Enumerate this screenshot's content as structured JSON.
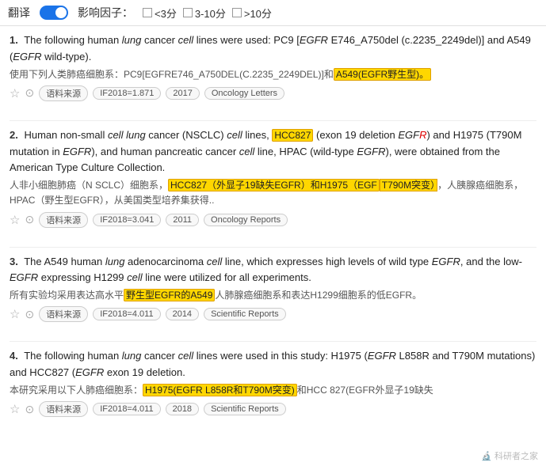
{
  "topbar": {
    "translate_label": "翻译",
    "factor_label": "影响因子：",
    "factor_options": [
      {
        "label": "<3分",
        "checked": false
      },
      {
        "label": "3-10分",
        "checked": false
      },
      {
        "label": ">10分",
        "checked": false
      }
    ]
  },
  "results": [
    {
      "num": "1.",
      "en_parts": [
        {
          "text": "The following human ",
          "style": "normal"
        },
        {
          "text": "lung",
          "style": "italic"
        },
        {
          "text": " cancer ",
          "style": "normal"
        },
        {
          "text": "cell",
          "style": "italic"
        },
        {
          "text": " lines were used: PC9 [",
          "style": "normal"
        },
        {
          "text": "EGFR",
          "style": "egfr"
        },
        {
          "text": " E746_A750del (c.2235_2249del)] and A549 (",
          "style": "normal"
        },
        {
          "text": "EGFR",
          "style": "egfr"
        },
        {
          "text": " wild-type).",
          "style": "normal"
        }
      ],
      "cn_parts": [
        {
          "text": "使用下列人类肺癌细胞系：PC9[EGFRE746_A750DEL(C.2235_2249DEL)]和",
          "style": "normal"
        },
        {
          "text": "A549(EGFR野生型)。",
          "style": "highlight"
        }
      ],
      "tags": [
        "语料来源",
        "IF2018=1.871",
        "2017",
        "Oncology Letters"
      ]
    },
    {
      "num": "2.",
      "en_parts": [
        {
          "text": "Human non-small ",
          "style": "normal"
        },
        {
          "text": "cell",
          "style": "italic"
        },
        {
          "text": " ",
          "style": "normal"
        },
        {
          "text": "lung",
          "style": "italic"
        },
        {
          "text": " cancer (NSCLC) ",
          "style": "normal"
        },
        {
          "text": "cell",
          "style": "italic"
        },
        {
          "text": " lines, ",
          "style": "normal"
        },
        {
          "text": "HCC827",
          "style": "highlight-inline"
        },
        {
          "text": " (exon 19 deletion ",
          "style": "normal"
        },
        {
          "text": "EGF",
          "style": "egfr"
        },
        {
          "text": "R) and H1975 (T790M mutation in ",
          "style": "normal"
        },
        {
          "text": "EGFR",
          "style": "egfr"
        },
        {
          "text": "), and human pancreatic cancer ",
          "style": "normal"
        },
        {
          "text": "cell",
          "style": "italic"
        },
        {
          "text": " line, HPAC (wild-type ",
          "style": "normal"
        },
        {
          "text": "EGFR",
          "style": "egfr"
        },
        {
          "text": "), were obtained from the American Type Culture Collection.",
          "style": "normal"
        }
      ],
      "cn_parts": [
        {
          "text": "人非小细胞肺癌（N SCLC）细胞系，",
          "style": "normal"
        },
        {
          "text": "HCC827（外显子19缺失EGFR）和H1975（EGF",
          "style": "highlight"
        },
        {
          "text": "T790M突变），人胰腺癌细胞系，HPAC（野生型EGFR），从美国类型培养集获得..",
          "style": "normal"
        }
      ],
      "tags": [
        "语料来源",
        "IF2018=3.041",
        "2011",
        "Oncology Reports"
      ]
    },
    {
      "num": "3.",
      "en_parts": [
        {
          "text": "The A549 human ",
          "style": "normal"
        },
        {
          "text": "lung",
          "style": "italic"
        },
        {
          "text": " adenocarcinoma ",
          "style": "normal"
        },
        {
          "text": "cell",
          "style": "italic"
        },
        {
          "text": " line, which expresses high levels of wild type ",
          "style": "normal"
        },
        {
          "text": "EGFR",
          "style": "egfr"
        },
        {
          "text": ", and the low-",
          "style": "normal"
        },
        {
          "text": "EGFR",
          "style": "egfr"
        },
        {
          "text": " expressing H1299 ",
          "style": "normal"
        },
        {
          "text": "cell",
          "style": "italic"
        },
        {
          "text": " line were utilized for all experiments.",
          "style": "normal"
        }
      ],
      "cn_parts": [
        {
          "text": "所有实验均采用表达高水平",
          "style": "normal"
        },
        {
          "text": "野生型EGFR的A549",
          "style": "highlight"
        },
        {
          "text": "人肺腺癌细胞系和表达H1299细胞系的低EGFR。",
          "style": "normal"
        }
      ],
      "tags": [
        "语料来源",
        "IF2018=4.011",
        "2014",
        "Scientific Reports"
      ]
    },
    {
      "num": "4.",
      "en_parts": [
        {
          "text": "The following human ",
          "style": "normal"
        },
        {
          "text": "lung",
          "style": "italic"
        },
        {
          "text": " cancer ",
          "style": "normal"
        },
        {
          "text": "cell",
          "style": "italic"
        },
        {
          "text": " lines were used in this study: H1975 (",
          "style": "normal"
        },
        {
          "text": "EGFR",
          "style": "egfr"
        },
        {
          "text": " L858R and T790M mutations) and HCC827 (",
          "style": "normal"
        },
        {
          "text": "EGFR",
          "style": "egfr"
        },
        {
          "text": " exon 19 deletion.",
          "style": "normal"
        }
      ],
      "cn_parts": [
        {
          "text": "本研究采用以下人肺癌细胞系：",
          "style": "normal"
        },
        {
          "text": "H1975(EGFR L858R和T790M突变)",
          "style": "highlight"
        },
        {
          "text": "和HCC 827(EGFR外显子19缺失",
          "style": "normal"
        }
      ],
      "tags": [
        "语料来源",
        "IF2018=4.011",
        "2018",
        "Scientific Reports"
      ]
    }
  ],
  "watermark": "科研者之家"
}
